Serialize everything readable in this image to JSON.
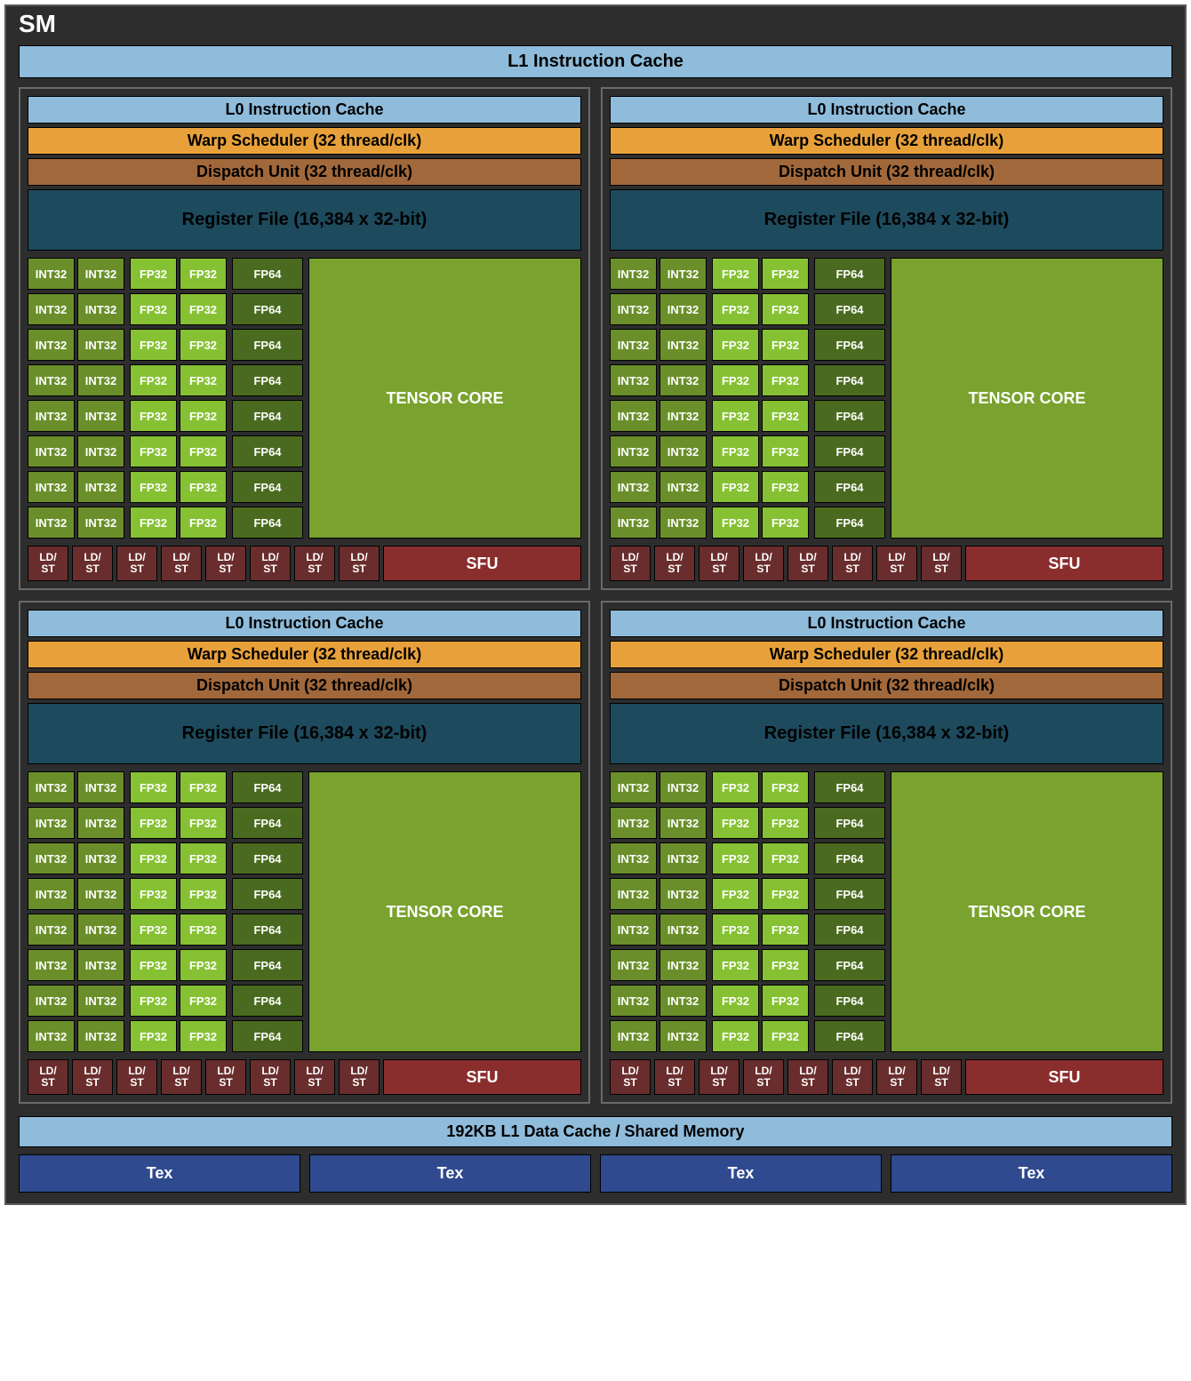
{
  "title": "SM",
  "l1_instruction_cache": "L1 Instruction Cache",
  "partition": {
    "l0_instruction_cache": "L0 Instruction Cache",
    "warp_scheduler": "Warp Scheduler (32 thread/clk)",
    "dispatch_unit": "Dispatch Unit (32 thread/clk)",
    "register_file": "Register File (16,384 x 32-bit)",
    "int32_label": "INT32",
    "fp32_label": "FP32",
    "fp64_label": "FP64",
    "tensor_core": "TENSOR CORE",
    "ldst_line1": "LD/",
    "ldst_line2": "ST",
    "sfu": "SFU",
    "rows": 8,
    "ldst_count": 8
  },
  "l1_data_cache": "192KB L1 Data Cache / Shared Memory",
  "tex_label": "Tex",
  "tex_count": 4,
  "partition_count": 4,
  "colors": {
    "background": "#2d2d2d",
    "cache_blue": "#8fbcdb",
    "warp_orange": "#e8a13a",
    "dispatch_brown": "#a1683b",
    "regfile_teal": "#1d4a5c",
    "int32_green": "#6a8f2a",
    "fp32_green": "#86c133",
    "fp64_green": "#4a6b1f",
    "tensor_green": "#79a22e",
    "ldst_maroon": "#6a2d2d",
    "sfu_red": "#8a2d2d",
    "tex_blue": "#2f4a8f"
  }
}
